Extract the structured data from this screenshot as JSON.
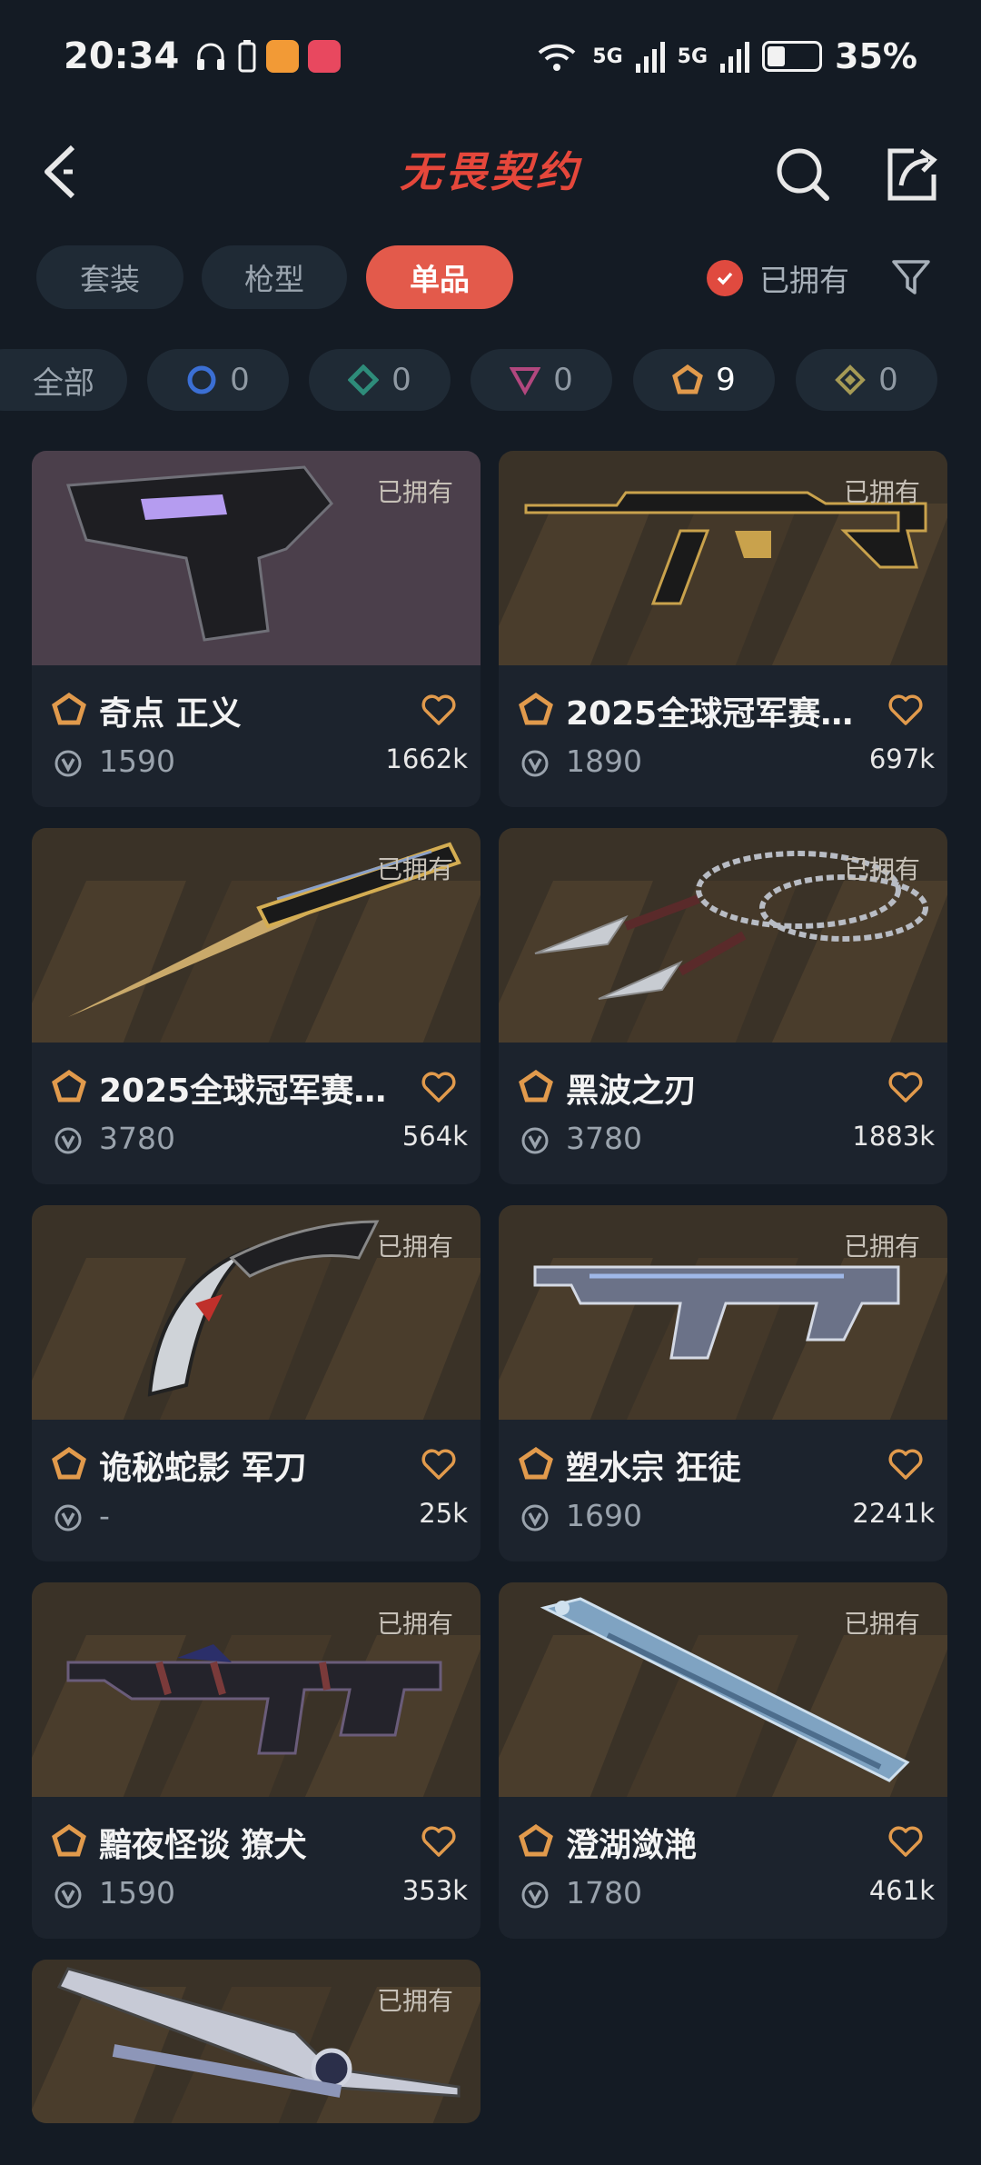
{
  "status": {
    "time": "20:34",
    "net1": "5G",
    "net2": "5G",
    "wifi_label": "6",
    "battery": "35%",
    "battery_level": 0.35
  },
  "header": {
    "title": "无畏契约"
  },
  "segments": [
    "套装",
    "枪型",
    "单品"
  ],
  "segment_active": 2,
  "owned_filter": {
    "label": "已拥有",
    "checked": true
  },
  "chips": [
    {
      "label": "全部",
      "count": ""
    },
    {
      "label": "",
      "count": "0",
      "icon": "circle-tier-icon",
      "color": "#3b6fd4"
    },
    {
      "label": "",
      "count": "0",
      "icon": "diamond-tier-icon",
      "color": "#2e8c7a"
    },
    {
      "label": "",
      "count": "0",
      "icon": "triangle-tier-icon",
      "color": "#b2477e"
    },
    {
      "label": "",
      "count": "9",
      "icon": "pentagon-tier-icon",
      "color": "#e19a4c"
    },
    {
      "label": "",
      "count": "0",
      "icon": "small-diamond-tier-icon",
      "color": "#a59a55"
    }
  ],
  "items": [
    {
      "name": "奇点 正义",
      "price": "1590",
      "likes": "1662k",
      "owned": "已拥有",
      "tier_color": "#e19a4c",
      "art": "revolver"
    },
    {
      "name": "2025全球冠军赛…",
      "price": "1890",
      "likes": "697k",
      "owned": "已拥有",
      "tier_color": "#e19a4c",
      "art": "rifle-gold"
    },
    {
      "name": "2025全球冠军赛…",
      "price": "3780",
      "likes": "564k",
      "owned": "已拥有",
      "tier_color": "#e19a4c",
      "art": "butterfly-knife"
    },
    {
      "name": "黑波之刃",
      "price": "3780",
      "likes": "1883k",
      "owned": "已拥有",
      "tier_color": "#e19a4c",
      "art": "kunai-chain"
    },
    {
      "name": "诡秘蛇影 军刀",
      "price": "-",
      "likes": "25k",
      "owned": "已拥有",
      "tier_color": "#e19a4c",
      "art": "claw-blade"
    },
    {
      "name": "塑水宗 狂徒",
      "price": "1690",
      "likes": "2241k",
      "owned": "已拥有",
      "tier_color": "#e19a4c",
      "art": "rifle-silver"
    },
    {
      "name": "黯夜怪谈 獠犬",
      "price": "1590",
      "likes": "353k",
      "owned": "已拥有",
      "tier_color": "#e19a4c",
      "art": "smg-dark"
    },
    {
      "name": "澄湖潋滟",
      "price": "1780",
      "likes": "461k",
      "owned": "已拥有",
      "tier_color": "#e19a4c",
      "art": "fan-blade"
    },
    {
      "name": "",
      "price": "",
      "likes": "",
      "owned": "已拥有",
      "tier_color": "#e19a4c",
      "art": "sword-silver"
    }
  ]
}
